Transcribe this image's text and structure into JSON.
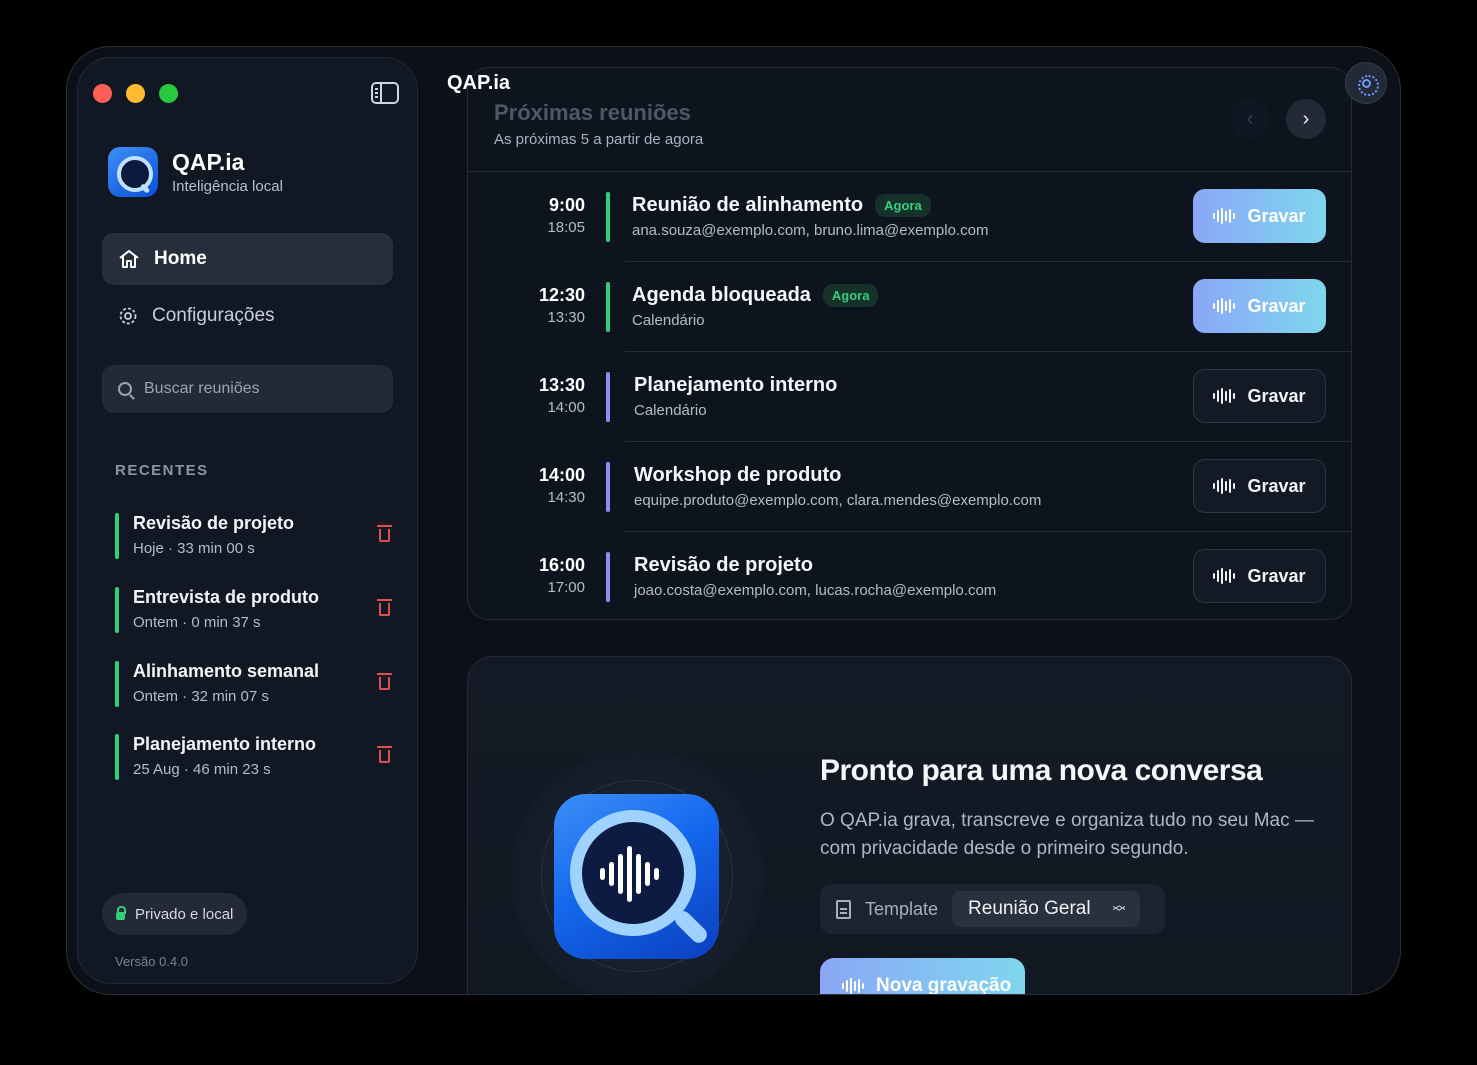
{
  "window": {
    "title": "QAP.ia"
  },
  "sidebar": {
    "brand": {
      "name": "QAP.ia",
      "subtitle": "Inteligência local"
    },
    "nav": [
      {
        "label": "Home",
        "icon": "home-icon",
        "active": true
      },
      {
        "label": "Configurações",
        "icon": "gear-icon",
        "active": false
      }
    ],
    "search": {
      "placeholder": "Buscar reuniões"
    },
    "recent_title": "RECENTES",
    "recent": [
      {
        "name": "Revisão de projeto",
        "meta": "Hoje · 33 min 00 s"
      },
      {
        "name": "Entrevista de produto",
        "meta": "Ontem · 0 min 37 s"
      },
      {
        "name": "Alinhamento semanal",
        "meta": "Ontem · 32 min 07 s"
      },
      {
        "name": "Planejamento interno",
        "meta": "25 Aug · 46 min 23 s"
      }
    ],
    "private_badge": "Privado e local",
    "version": "Versão 0.4.0"
  },
  "upcoming": {
    "title": "Próximas reuniões",
    "subtitle": "As próximas 5 a partir de agora",
    "items": [
      {
        "start": "9:00",
        "end": "18:05",
        "title": "Reunião de alinhamento",
        "badge": "Agora",
        "sub": "ana.souza@exemplo.com, bruno.lima@exemplo.com",
        "bar_color": "#2fd07a",
        "button": "Gravar",
        "primary": true
      },
      {
        "start": "12:30",
        "end": "13:30",
        "title": "Agenda bloqueada",
        "badge": "Agora",
        "sub": "Calendário",
        "bar_color": "#2fd07a",
        "button": "Gravar",
        "primary": true
      },
      {
        "start": "13:30",
        "end": "14:00",
        "title": "Planejamento interno",
        "badge": "",
        "sub": "Calendário",
        "bar_color": "#8f8ff0",
        "button": "Gravar",
        "primary": false
      },
      {
        "start": "14:00",
        "end": "14:30",
        "title": "Workshop de produto",
        "badge": "",
        "sub": "equipe.produto@exemplo.com, clara.mendes@exemplo.com",
        "bar_color": "#8f8ff0",
        "button": "Gravar",
        "primary": false
      },
      {
        "start": "16:00",
        "end": "17:00",
        "title": "Revisão de projeto",
        "badge": "",
        "sub": "joao.costa@exemplo.com, lucas.rocha@exemplo.com",
        "bar_color": "#8f8ff0",
        "button": "Gravar",
        "primary": false
      }
    ]
  },
  "ready": {
    "title": "Pronto para uma nova conversa",
    "description": "O QAP.ia grava, transcreve e organiza tudo no seu Mac — com privacidade desde o primeiro segundo.",
    "template_label": "Template",
    "template_value": "Reunião Geral",
    "new_recording": "Nova gravação"
  },
  "colors": {
    "accent_gradient_start": "#8aa7f7",
    "accent_gradient_end": "#7fd6ee",
    "success": "#2fd07a",
    "danger": "#d9504f",
    "background": "#0b1019"
  }
}
